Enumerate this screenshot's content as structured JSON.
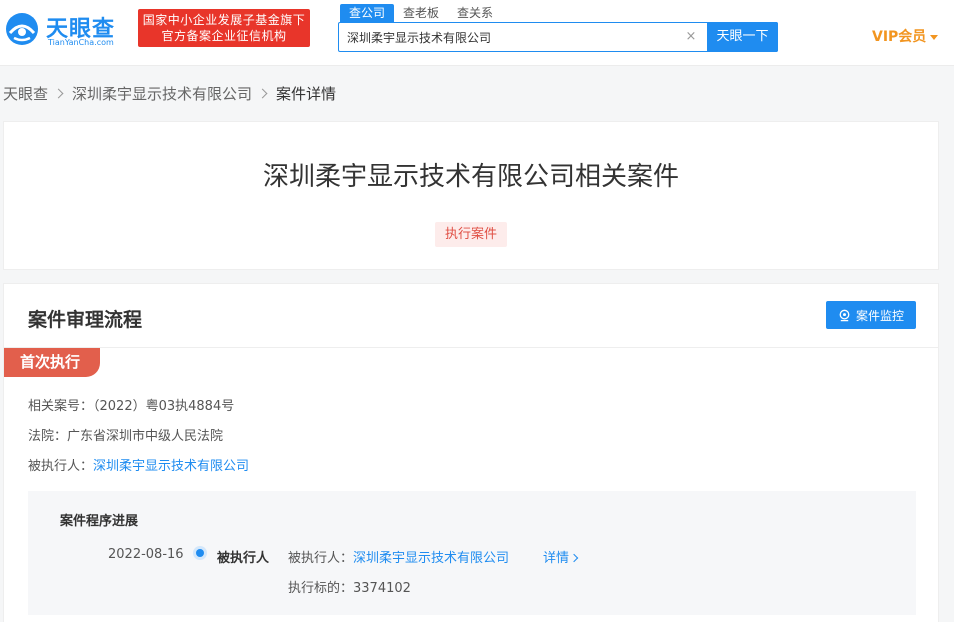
{
  "header": {
    "logo": {
      "name": "天眼查",
      "sub": "TianYanCha.com"
    },
    "slogan": {
      "line1": "国家中小企业发展子基金旗下",
      "line2": "官方备案企业征信机构"
    },
    "search_tabs": [
      "查公司",
      "查老板",
      "查关系"
    ],
    "search": {
      "value": "深圳柔宇显示技术有限公司",
      "clear": "×",
      "button": "天眼一下"
    },
    "vip": "VIP会员"
  },
  "breadcrumb": [
    "天眼查",
    "深圳柔宇显示技术有限公司",
    "案件详情"
  ],
  "title_card": {
    "title": "深圳柔宇显示技术有限公司相关案件",
    "tag": "执行案件"
  },
  "process": {
    "section_title": "案件审理流程",
    "monitor_button": "案件监控",
    "stage": "首次执行",
    "case_no_label": "相关案号：",
    "case_no": "（2022）粤03执4884号",
    "court_label": "法院：",
    "court": "广东省深圳市中级人民法院",
    "executed_label": "被执行人：",
    "executed": "深圳柔宇显示技术有限公司",
    "progress": {
      "title": "案件程序进展",
      "date": "2022-08-16",
      "role": "被执行人",
      "party_label": "被执行人：",
      "party": "深圳柔宇显示技术有限公司",
      "detail": "详情",
      "amount_label": "执行标的：",
      "amount": "3374102"
    }
  },
  "colors": {
    "brand": "#1f8cf0",
    "slogan_red": "#e8352a",
    "vip": "#f29520",
    "ribbon": "#e25f4c"
  }
}
